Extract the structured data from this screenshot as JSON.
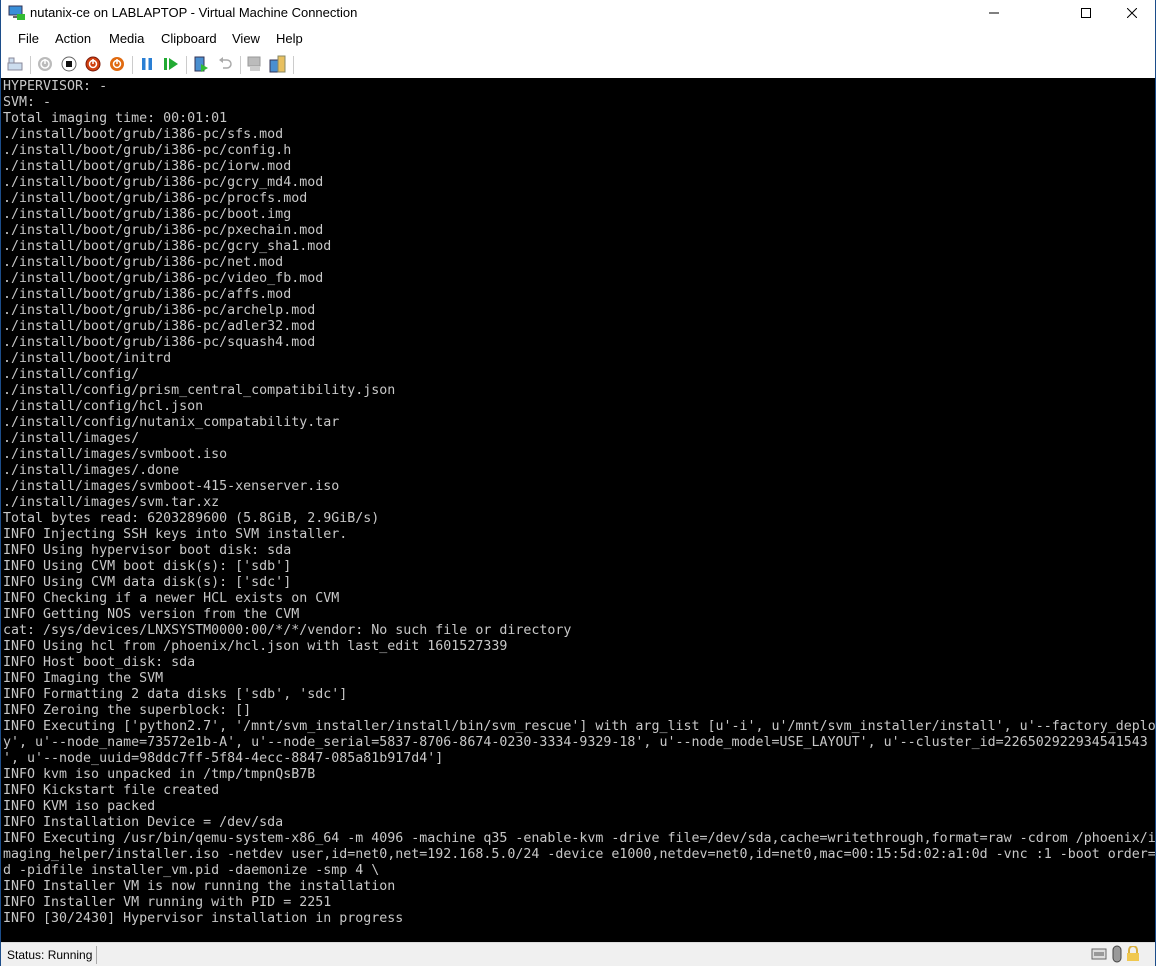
{
  "window": {
    "title": "nutanix-ce on LABLAPTOP - Virtual Machine Connection"
  },
  "menu": [
    "File",
    "Action",
    "Media",
    "Clipboard",
    "View",
    "Help"
  ],
  "toolbar": [
    "ctrl-alt-del",
    "start",
    "turn-off",
    "shut-down",
    "save",
    "pause",
    "resume",
    "checkpoint",
    "revert",
    "enhanced-session",
    "share"
  ],
  "colors": {
    "console_bg": "#000000",
    "console_fg": "#c8c8c8",
    "shutdown": "#d04010",
    "pause": "#2a7fd4",
    "resume": "#22aa33"
  },
  "console": {
    "lines": [
      "HYPERVISOR: -",
      "SVM: -",
      "Total imaging time: 00:01:01",
      "./install/boot/grub/i386-pc/sfs.mod",
      "./install/boot/grub/i386-pc/config.h",
      "./install/boot/grub/i386-pc/iorw.mod",
      "./install/boot/grub/i386-pc/gcry_md4.mod",
      "./install/boot/grub/i386-pc/procfs.mod",
      "./install/boot/grub/i386-pc/boot.img",
      "./install/boot/grub/i386-pc/pxechain.mod",
      "./install/boot/grub/i386-pc/gcry_sha1.mod",
      "./install/boot/grub/i386-pc/net.mod",
      "./install/boot/grub/i386-pc/video_fb.mod",
      "./install/boot/grub/i386-pc/affs.mod",
      "./install/boot/grub/i386-pc/archelp.mod",
      "./install/boot/grub/i386-pc/adler32.mod",
      "./install/boot/grub/i386-pc/squash4.mod",
      "./install/boot/initrd",
      "./install/config/",
      "./install/config/prism_central_compatibility.json",
      "./install/config/hcl.json",
      "./install/config/nutanix_compatability.tar",
      "./install/images/",
      "./install/images/svmboot.iso",
      "./install/images/.done",
      "./install/images/svmboot-415-xenserver.iso",
      "./install/images/svm.tar.xz",
      "Total bytes read: 6203289600 (5.8GiB, 2.9GiB/s)",
      "INFO Injecting SSH keys into SVM installer.",
      "INFO Using hypervisor boot disk: sda",
      "INFO Using CVM boot disk(s): ['sdb']",
      "INFO Using CVM data disk(s): ['sdc']",
      "INFO Checking if a newer HCL exists on CVM",
      "INFO Getting NOS version from the CVM",
      "cat: /sys/devices/LNXSYSTM0000:00/*/*/vendor: No such file or directory",
      "INFO Using hcl from /phoenix/hcl.json with last_edit 1601527339",
      "INFO Host boot_disk: sda",
      "INFO Imaging the SVM",
      "INFO Formatting 2 data disks ['sdb', 'sdc']",
      "INFO Zeroing the superblock: []",
      "INFO Executing ['python2.7', '/mnt/svm_installer/install/bin/svm_rescue'] with arg_list [u'-i', u'/mnt/svm_installer/install', u'--factory_deplo",
      "y', u'--node_name=73572e1b-A', u'--node_serial=5837-8706-8674-0230-3334-9329-18', u'--node_model=USE_LAYOUT', u'--cluster_id=226502922934541543",
      "', u'--node_uuid=98ddc7ff-5f84-4ecc-8847-085a81b917d4']",
      "INFO kvm iso unpacked in /tmp/tmpnQsB7B",
      "INFO Kickstart file created",
      "INFO KVM iso packed",
      "INFO Installation Device = /dev/sda",
      "INFO Executing /usr/bin/qemu-system-x86_64 -m 4096 -machine q35 -enable-kvm -drive file=/dev/sda,cache=writethrough,format=raw -cdrom /phoenix/i",
      "maging_helper/installer.iso -netdev user,id=net0,net=192.168.5.0/24 -device e1000,netdev=net0,id=net0,mac=00:15:5d:02:a1:0d -vnc :1 -boot order=",
      "d -pidfile installer_vm.pid -daemonize -smp 4 \\",
      "INFO Installer VM is now running the installation",
      "INFO Installer VM running with PID = 2251",
      "INFO [30/2430] Hypervisor installation in progress"
    ]
  },
  "status": {
    "text": "Status: Running"
  }
}
